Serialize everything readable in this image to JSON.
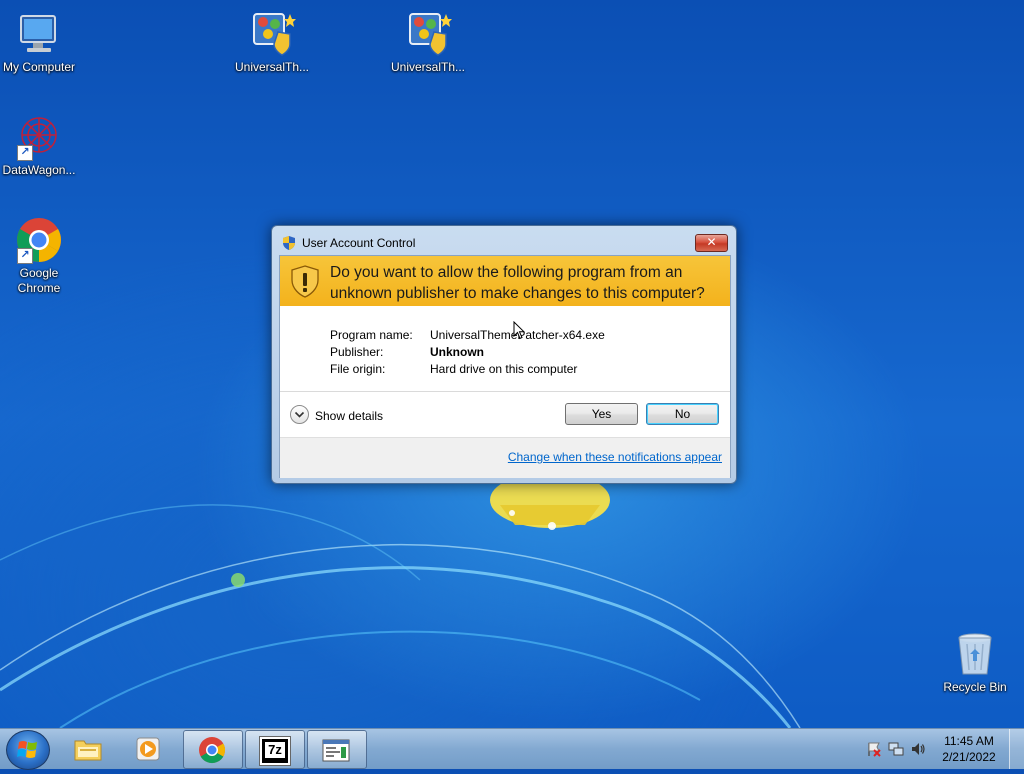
{
  "desktop": {
    "icons": [
      {
        "label": "My Computer"
      },
      {
        "label": "UniversalTh..."
      },
      {
        "label": "UniversalTh..."
      },
      {
        "label": "DataWagon..."
      },
      {
        "label": "Google Chrome"
      },
      {
        "label": "Recycle Bin"
      }
    ]
  },
  "uac": {
    "title": "User Account Control",
    "close_glyph": "✕",
    "heading": "Do you want to allow the following program from an unknown publisher to make changes to this computer?",
    "program_name_label": "Program name:",
    "program_name_value": "UniversalThemePatcher-x64.exe",
    "publisher_label": "Publisher:",
    "publisher_value": "Unknown",
    "file_origin_label": "File origin:",
    "file_origin_value": "Hard drive on this computer",
    "show_details": "Show details",
    "yes_label": "Yes",
    "no_label": "No",
    "change_link": "Change when these notifications appear"
  },
  "taskbar": {
    "buttons": [
      {
        "icon": "explorer-icon"
      },
      {
        "icon": "media-player-icon"
      },
      {
        "icon": "chrome-icon"
      },
      {
        "icon": "7zip-icon"
      },
      {
        "icon": "app-window-icon"
      }
    ],
    "seven_zip_text": "7z",
    "time": "11:45 AM",
    "date": "2/21/2022"
  },
  "colors": {
    "banner": "#f3b21c",
    "link": "#0066cc",
    "desktop": "#1668cf"
  }
}
